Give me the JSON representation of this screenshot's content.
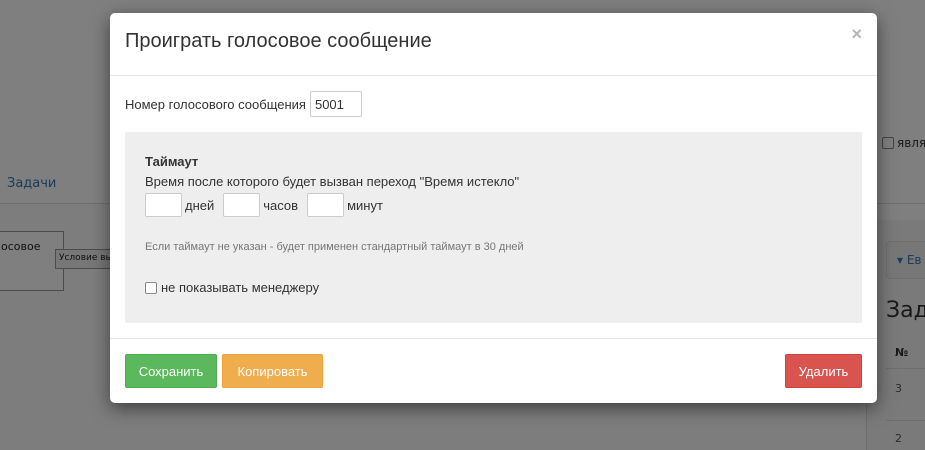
{
  "background": {
    "tab_label": "Задачи",
    "node_label": "осовое",
    "condition_label": "Условие вы",
    "checkbox_label": "явля",
    "dropdown_label": "▾ Ев",
    "heading": "Зад",
    "table_header": "№",
    "rows": [
      "3",
      "2"
    ],
    "link_color": "#337ab7"
  },
  "modal": {
    "title": "Проиграть голосовое сообщение",
    "close_icon": "×",
    "message_label": "Номер голосового сообщения",
    "message_value": "5001",
    "timeout": {
      "title": "Таймаут",
      "description": "Время после которого будет вызван переход \"Время истекло\"",
      "days_value": "",
      "days_unit": "дней",
      "hours_value": "",
      "hours_unit": "часов",
      "minutes_value": "",
      "minutes_unit": "минут",
      "hint": "Если таймаут не указан - будет применен стандартный таймаут в 30 дней",
      "hide_checkbox_label": "не показывать менеджеру",
      "hide_checked": false
    },
    "buttons": {
      "save": "Сохранить",
      "copy": "Копировать",
      "delete": "Удалить"
    },
    "colors": {
      "save": "#5cb85c",
      "copy": "#f0ad4e",
      "delete": "#d9534f"
    }
  }
}
